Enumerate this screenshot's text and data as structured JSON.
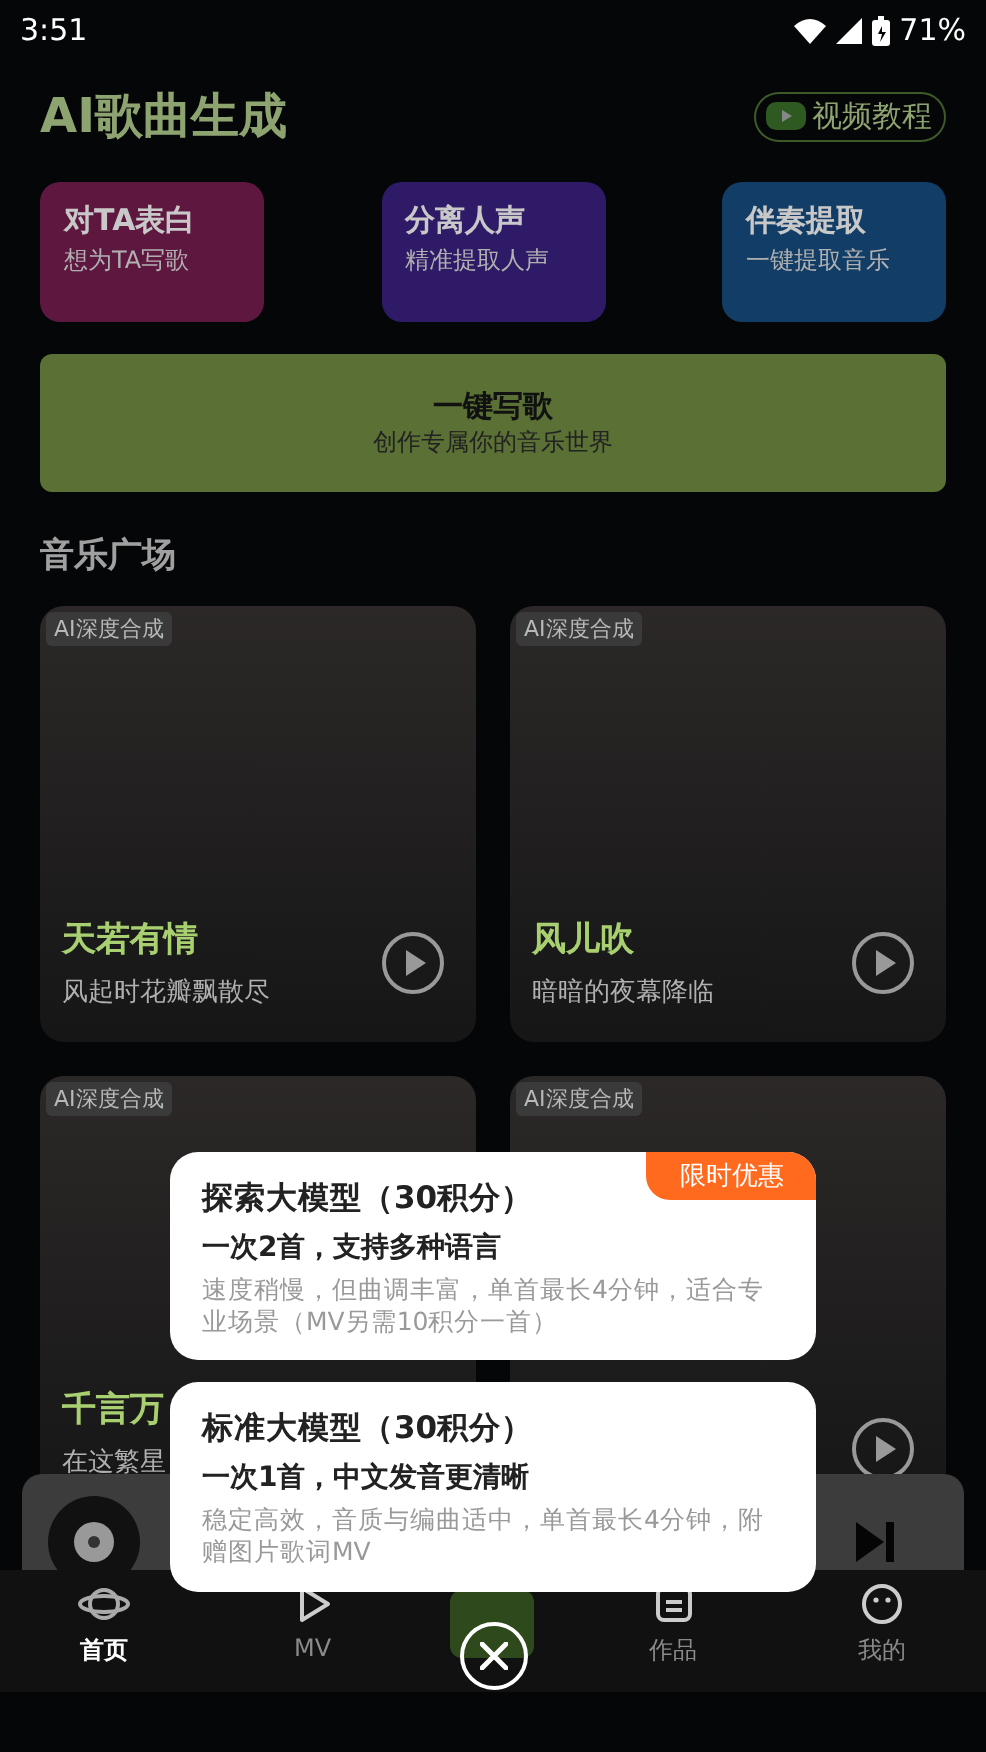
{
  "status_bar": {
    "time": "3:51",
    "battery": "71%"
  },
  "header": {
    "title": "AI歌曲生成",
    "tutorial_button": "视频教程"
  },
  "features": [
    {
      "title": "对TA表白",
      "subtitle": "想为TA写歌",
      "color": "#5e1840"
    },
    {
      "title": "分离人声",
      "subtitle": "精准提取人声",
      "color": "#2e1a66"
    },
    {
      "title": "伴奏提取",
      "subtitle": "一键提取音乐",
      "color": "#123d66"
    }
  ],
  "main_action": {
    "title": "一键写歌",
    "subtitle": "创作专属你的音乐世界"
  },
  "section_title": "音乐广场",
  "songs": [
    {
      "badge": "AI深度合成",
      "title": "天若有情",
      "subtitle": "风起时花瓣飘散尽"
    },
    {
      "badge": "AI深度合成",
      "title": "风儿吹",
      "subtitle": "暗暗的夜幕降临"
    },
    {
      "badge": "AI深度合成",
      "title": "千言万",
      "subtitle": "在这繁星"
    },
    {
      "badge": "AI深度合成"
    }
  ],
  "options": [
    {
      "title": "探索大模型（30积分）",
      "feature": "一次2首，支持多种语言",
      "description": "速度稍慢，但曲调丰富，单首最长4分钟，适合专业场景（MV另需10积分一首）",
      "badge": "限时优惠"
    },
    {
      "title": "标准大模型（30积分）",
      "feature": "一次1首，中文发音更清晰",
      "description": "稳定高效，音质与编曲适中，单首最长4分钟，附赠图片歌词MV"
    }
  ],
  "nav": [
    {
      "kind": "home",
      "label": "首页",
      "selected": true
    },
    {
      "kind": "mv",
      "label": "MV",
      "selected": false
    },
    {
      "kind": "create",
      "selected": false
    },
    {
      "kind": "works",
      "label": "作品",
      "selected": false
    },
    {
      "kind": "mine",
      "label": "我的",
      "selected": false
    }
  ]
}
